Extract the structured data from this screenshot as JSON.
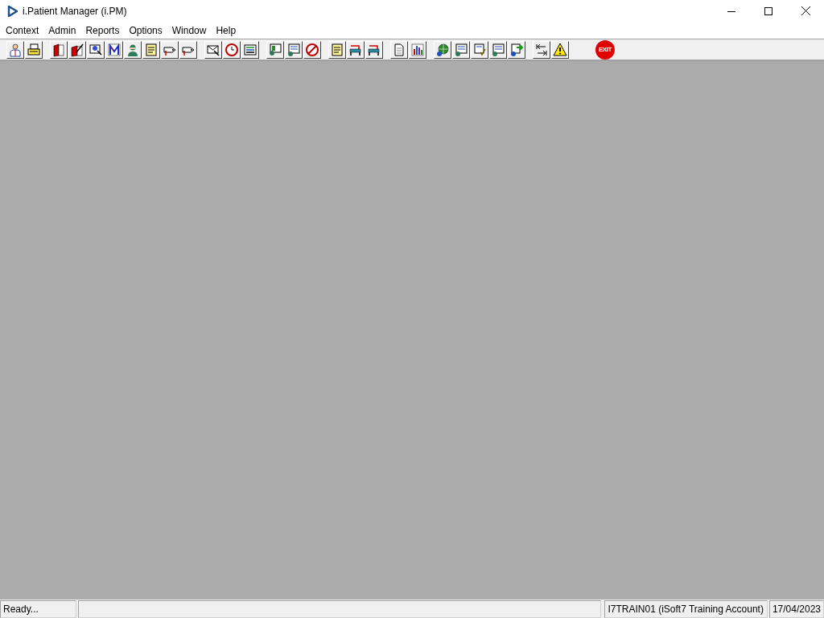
{
  "window": {
    "title": "i.Patient Manager (i.PM)"
  },
  "menu": [
    {
      "label": "Context"
    },
    {
      "label": "Admin"
    },
    {
      "label": "Reports"
    },
    {
      "label": "Options"
    },
    {
      "label": "Window"
    },
    {
      "label": "Help"
    }
  ],
  "toolbar": {
    "groups": [
      {
        "buttons": [
          {
            "kind": "person"
          },
          {
            "kind": "printer"
          }
        ]
      },
      {
        "buttons": [
          {
            "kind": "book"
          },
          {
            "kind": "edit"
          },
          {
            "kind": "search"
          },
          {
            "kind": "letter"
          },
          {
            "kind": "doctor"
          },
          {
            "kind": "note"
          },
          {
            "kind": "tag"
          },
          {
            "kind": "tag"
          }
        ]
      },
      {
        "buttons": [
          {
            "kind": "envelope"
          },
          {
            "kind": "clock"
          },
          {
            "kind": "list"
          }
        ]
      },
      {
        "buttons": [
          {
            "kind": "screen"
          },
          {
            "kind": "form"
          },
          {
            "kind": "nosign"
          }
        ]
      },
      {
        "buttons": [
          {
            "kind": "note"
          },
          {
            "kind": "bed"
          },
          {
            "kind": "bed"
          }
        ]
      },
      {
        "buttons": [
          {
            "kind": "page"
          },
          {
            "kind": "chart"
          }
        ]
      },
      {
        "buttons": [
          {
            "kind": "globe"
          },
          {
            "kind": "form"
          },
          {
            "kind": "check"
          },
          {
            "kind": "form"
          },
          {
            "kind": "swap"
          }
        ]
      },
      {
        "buttons": [
          {
            "kind": "arrows"
          },
          {
            "kind": "warning"
          }
        ]
      },
      {
        "buttons": [
          {
            "kind": "stop",
            "label": "EXIT"
          }
        ]
      }
    ]
  },
  "status_bar": {
    "message": "Ready...",
    "user": "I7TRAIN01 (iSoft7 Training Account)",
    "date": "17/04/2023"
  }
}
